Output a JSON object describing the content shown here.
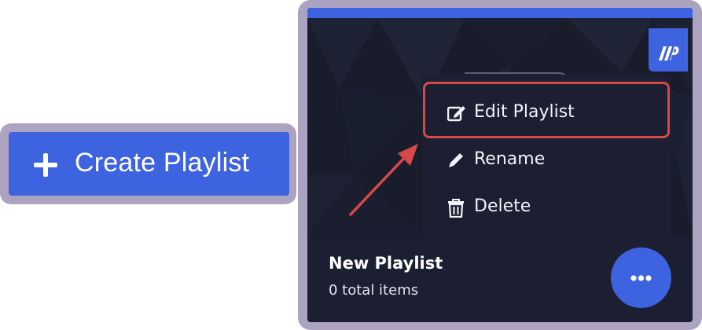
{
  "create_button": {
    "label": "Create Playlist",
    "icon": "plus-icon"
  },
  "playlist_card": {
    "title": "New Playlist",
    "subtitle": "0 total items",
    "brand_icon": "brand-logo-icon",
    "more_icon": "ellipsis-icon"
  },
  "menu": {
    "items": [
      {
        "label": "Edit Playlist",
        "icon": "edit-icon",
        "highlighted": true
      },
      {
        "label": "Rename",
        "icon": "pencil-icon"
      },
      {
        "label": "Delete",
        "icon": "trash-icon"
      }
    ]
  },
  "colors": {
    "accent": "#3d63e0",
    "halo": "#aca3c1",
    "card_bg": "#1b1f31",
    "highlight": "#d7484a"
  }
}
